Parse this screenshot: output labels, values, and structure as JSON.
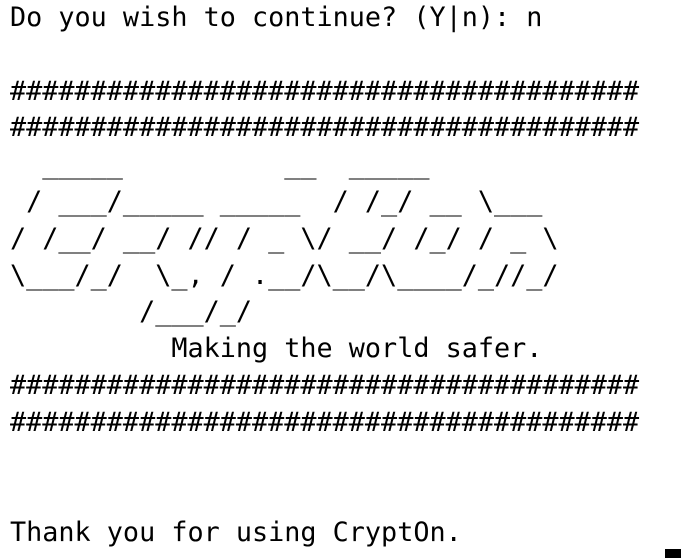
{
  "terminal": {
    "lines": [
      "Do you wish to continue? (Y|n): n",
      "",
      "#######################################",
      "#######################################",
      "  _____          __  _____",
      " / ___/_____ _____  / /_/ __ \\___",
      "/ /__/ __/ // / _ \\/ __/ /_/ / _ \\",
      "\\___/_/  \\_, / .__/\\__/\\____/_//_/",
      "        /___/_/",
      "          Making the world safer.",
      "#######################################",
      "#######################################",
      "",
      "",
      "Thank you for using CryptOn."
    ]
  }
}
